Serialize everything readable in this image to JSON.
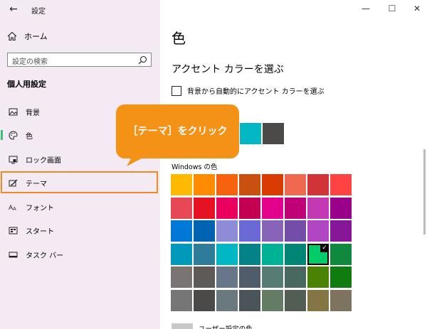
{
  "window": {
    "app_title": "設定",
    "controls": {
      "minimize": "—",
      "maximize": "☐",
      "close": "✕"
    },
    "back_icon": "←"
  },
  "sidebar": {
    "home_label": "ホーム",
    "search_placeholder": "設定の検索",
    "section_title": "個人用設定",
    "items": [
      {
        "label": "背景",
        "icon": "picture-icon"
      },
      {
        "label": "色",
        "icon": "palette-icon",
        "selected": true
      },
      {
        "label": "ロック画面",
        "icon": "lock-screen-icon"
      },
      {
        "label": "テーマ",
        "icon": "theme-icon",
        "highlighted": true
      },
      {
        "label": "フォント",
        "icon": "font-icon"
      },
      {
        "label": "スタート",
        "icon": "start-icon"
      },
      {
        "label": "タスク バー",
        "icon": "taskbar-icon"
      }
    ]
  },
  "main": {
    "page_title": "色",
    "accent_heading": "アクセント カラーを選ぶ",
    "auto_accent_label": "背景から自動的にアクセント カラーを選ぶ",
    "auto_accent_checked": false,
    "recent_colors": [
      "#00b7c3",
      "#4c4a48"
    ],
    "windows_colors_label": "Windows の色",
    "windows_colors": [
      [
        "#ffb900",
        "#ff8c00",
        "#f7630c",
        "#ca5010",
        "#da3b01",
        "#ef6950",
        "#d13438",
        "#ff4343"
      ],
      [
        "#e74856",
        "#e81123",
        "#ea005e",
        "#c30052",
        "#e3008c",
        "#bf0077",
        "#c239b3",
        "#9a0089"
      ],
      [
        "#0078d7",
        "#0063b1",
        "#8e8cd8",
        "#6b69d6",
        "#8764b8",
        "#744da9",
        "#b146c2",
        "#881798"
      ],
      [
        "#0099bc",
        "#2d7d9a",
        "#00b7c3",
        "#038387",
        "#00b294",
        "#018574",
        "#00cc6a",
        "#10893e"
      ],
      [
        "#7a7574",
        "#5d5a58",
        "#68768a",
        "#515c6b",
        "#567c73",
        "#486860",
        "#498205",
        "#107c10"
      ],
      [
        "#767676",
        "#4c4a48",
        "#69797e",
        "#4a5459",
        "#647c64",
        "#525e54",
        "#847545",
        "#7e735f"
      ]
    ],
    "selected_color": {
      "row": 3,
      "col": 6
    },
    "custom_color_label": "ユーザー設定の色"
  },
  "callout": {
    "text": "［テーマ］をクリック",
    "color": "#f39216"
  },
  "accent": {
    "highlight_border": "#f08a20",
    "selection_indicator": "#3fbf76"
  }
}
